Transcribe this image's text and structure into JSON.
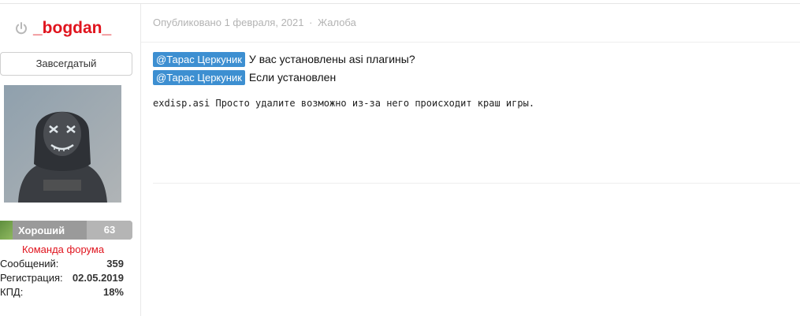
{
  "author": {
    "name": "_bogdan_",
    "title": "Завсегдатый",
    "reputation_label": "Хороший",
    "reputation_count": "63",
    "group": "Команда форума",
    "stats": [
      {
        "label": "Сообщений:",
        "value": "359"
      },
      {
        "label": "Регистрация:",
        "value": "02.05.2019"
      },
      {
        "label": "КПД:",
        "value": "18%"
      }
    ]
  },
  "post": {
    "meta": "Опубликовано 1 февраля, 2021",
    "separator": "·",
    "report": "Жалоба",
    "lines": [
      {
        "mention": "@Тарас Церкуник",
        "text": "У вас установлены asi плагины?"
      },
      {
        "mention": "@Тарас Церкуник",
        "text": "Если установлен"
      }
    ],
    "code_text": "exdisp.asi Просто удалите возможно из-за него происходит краш игры."
  },
  "colors": {
    "author_name": "#e0141e",
    "mention_bg": "#3d8fd1",
    "reputation_stripe": "#6b9c47",
    "group": "#e0141e"
  }
}
